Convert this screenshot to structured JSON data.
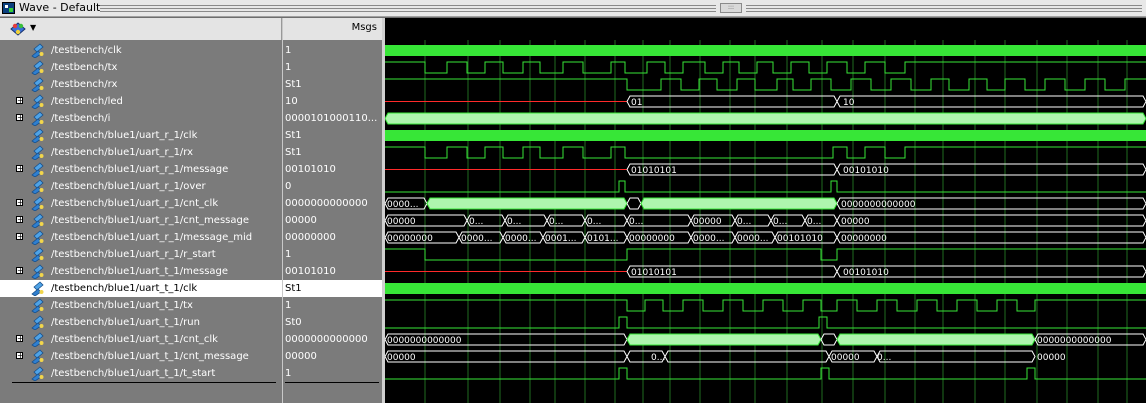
{
  "window": {
    "title": "Wave - Default"
  },
  "panes": {
    "messages_header": "Msgs"
  },
  "signals": [
    {
      "name": "/testbench/clk",
      "value": "1",
      "expandable": false
    },
    {
      "name": "/testbench/tx",
      "value": "1",
      "expandable": false
    },
    {
      "name": "/testbench/rx",
      "value": "St1",
      "expandable": false
    },
    {
      "name": "/testbench/led",
      "value": "10",
      "expandable": true
    },
    {
      "name": "/testbench/i",
      "value": "0000101000110...",
      "expandable": true
    },
    {
      "name": "/testbench/blue1/uart_r_1/clk",
      "value": "St1",
      "expandable": false
    },
    {
      "name": "/testbench/blue1/uart_r_1/rx",
      "value": "St1",
      "expandable": false
    },
    {
      "name": "/testbench/blue1/uart_r_1/message",
      "value": "00101010",
      "expandable": true
    },
    {
      "name": "/testbench/blue1/uart_r_1/over",
      "value": "0",
      "expandable": false
    },
    {
      "name": "/testbench/blue1/uart_r_1/cnt_clk",
      "value": "0000000000000",
      "expandable": true
    },
    {
      "name": "/testbench/blue1/uart_r_1/cnt_message",
      "value": "00000",
      "expandable": true
    },
    {
      "name": "/testbench/blue1/uart_r_1/message_mid",
      "value": "00000000",
      "expandable": true
    },
    {
      "name": "/testbench/blue1/uart_r_1/r_start",
      "value": "1",
      "expandable": false
    },
    {
      "name": "/testbench/blue1/uart_t_1/message",
      "value": "00101010",
      "expandable": true
    },
    {
      "name": "/testbench/blue1/uart_t_1/clk",
      "value": "St1",
      "expandable": false,
      "selected": true
    },
    {
      "name": "/testbench/blue1/uart_t_1/tx",
      "value": "1",
      "expandable": false
    },
    {
      "name": "/testbench/blue1/uart_t_1/run",
      "value": "St0",
      "expandable": false
    },
    {
      "name": "/testbench/blue1/uart_t_1/cnt_clk",
      "value": "0000000000000",
      "expandable": true
    },
    {
      "name": "/testbench/blue1/uart_t_1/cnt_message",
      "value": "00000",
      "expandable": true
    },
    {
      "name": "/testbench/blue1/uart_t_1/t_start",
      "value": "1",
      "expandable": false
    }
  ],
  "wave_labels": {
    "led": [
      "01",
      "10"
    ],
    "r_message": [
      "01010101",
      "00101010"
    ],
    "r_cnt_clk": [
      "0000...",
      "0000000000000"
    ],
    "r_cnt_message": [
      "00000",
      "0...",
      "0...",
      "0...",
      "0...",
      "0...",
      "00000",
      "0...",
      "0...",
      "0...",
      "00000"
    ],
    "r_message_mid": [
      "00000000",
      "0000...",
      "0000...",
      "0001...",
      "0101...",
      "00000000",
      "0000...",
      "0000...",
      "00101010",
      "00000000"
    ],
    "t_message": [
      "01010101",
      "00101010"
    ],
    "t_cnt_clk": [
      "0000000000000",
      "0000000000000"
    ],
    "t_cnt_message": [
      "00000",
      "0...",
      "00000",
      "0...",
      "00000"
    ]
  },
  "colors": {
    "wave": "#37e637",
    "bus_fill": "#aef5ae",
    "led_pre": "#ff2a2a",
    "grid": "#1f6b1f",
    "background": "#000000"
  }
}
